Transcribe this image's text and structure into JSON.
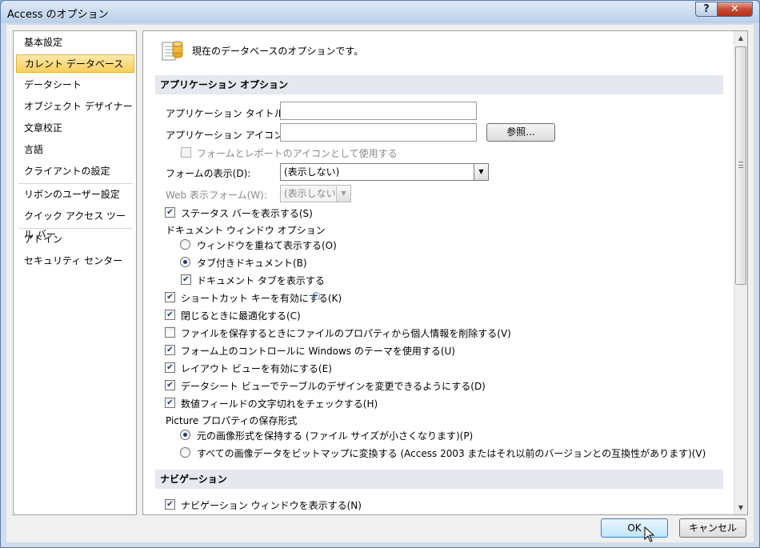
{
  "window": {
    "title": "Access のオプション",
    "help_glyph": "?",
    "close_glyph": "✕"
  },
  "nav": {
    "items": [
      {
        "label": "基本設定"
      },
      {
        "label": "カレント データベース",
        "selected": true
      },
      {
        "label": "データシート"
      },
      {
        "label": "オブジェクト デザイナー"
      },
      {
        "label": "文章校正"
      },
      {
        "label": "言語"
      },
      {
        "label": "クライアントの設定"
      },
      {
        "label": "リボンのユーザー設定"
      },
      {
        "label": "クイック アクセス ツール バー"
      },
      {
        "label": "アドイン"
      },
      {
        "label": "セキュリティ センター"
      }
    ]
  },
  "panel": {
    "header_text": "現在のデータベースのオプションです。",
    "app_section": {
      "title": "アプリケーション オプション",
      "app_title_label": "アプリケーション タイトル(T):",
      "app_title_value": "",
      "app_icon_label": "アプリケーション アイコン(I):",
      "app_icon_value": "",
      "browse_label": "参照...",
      "use_icon_label": "フォームとレポートのアイコンとして使用する",
      "display_form_label": "フォームの表示(D):",
      "display_form_value": "(表示しない)",
      "web_form_label": "Web 表示フォーム(W):",
      "web_form_value": "(表示しない)",
      "status_bar_label": "ステータス バーを表示する(S)",
      "doc_window_label": "ドキュメント ウィンドウ オプション",
      "overlap_label": "ウィンドウを重ねて表示する(O)",
      "tabbed_label": "タブ付きドキュメント(B)",
      "doc_tabs_label": "ドキュメント タブを表示する",
      "shortcut_label": "ショートカット キーを有効にする(K)",
      "compact_label": "閉じるときに最適化する(C)",
      "remove_info_label": "ファイルを保存するときにファイルのプロパティから個人情報を削除する(V)",
      "windows_theme_label": "フォーム上のコントロールに Windows のテーマを使用する(U)",
      "layout_view_label": "レイアウト ビューを有効にする(E)",
      "datasheet_design_label": "データシート ビューでテーブルのデザインを変更できるようにする(D)",
      "truncation_label": "数値フィールドの文字切れをチェックする(H)",
      "picture_format_label": "Picture プロパティの保存形式",
      "preserve_label": "元の画像形式を保持する (ファイル サイズが小さくなります)(P)",
      "bitmap_label": "すべての画像データをビットマップに変換する (Access 2003 またはそれ以前のバージョンとの互換性があります)(V)"
    },
    "nav_section": {
      "title": "ナビゲーション",
      "show_nav_label": "ナビゲーション ウィンドウを表示する(N)"
    },
    "states": {
      "use_icon": false,
      "status_bar": true,
      "overlap": false,
      "tabbed": true,
      "doc_tabs": true,
      "shortcut": true,
      "compact": true,
      "remove_info": false,
      "windows_theme": true,
      "layout_view": true,
      "datasheet_design": true,
      "truncation": true,
      "preserve": true,
      "bitmap": false,
      "show_nav": true
    }
  },
  "footer": {
    "ok_label": "OK",
    "cancel_label": "キャンセル"
  }
}
